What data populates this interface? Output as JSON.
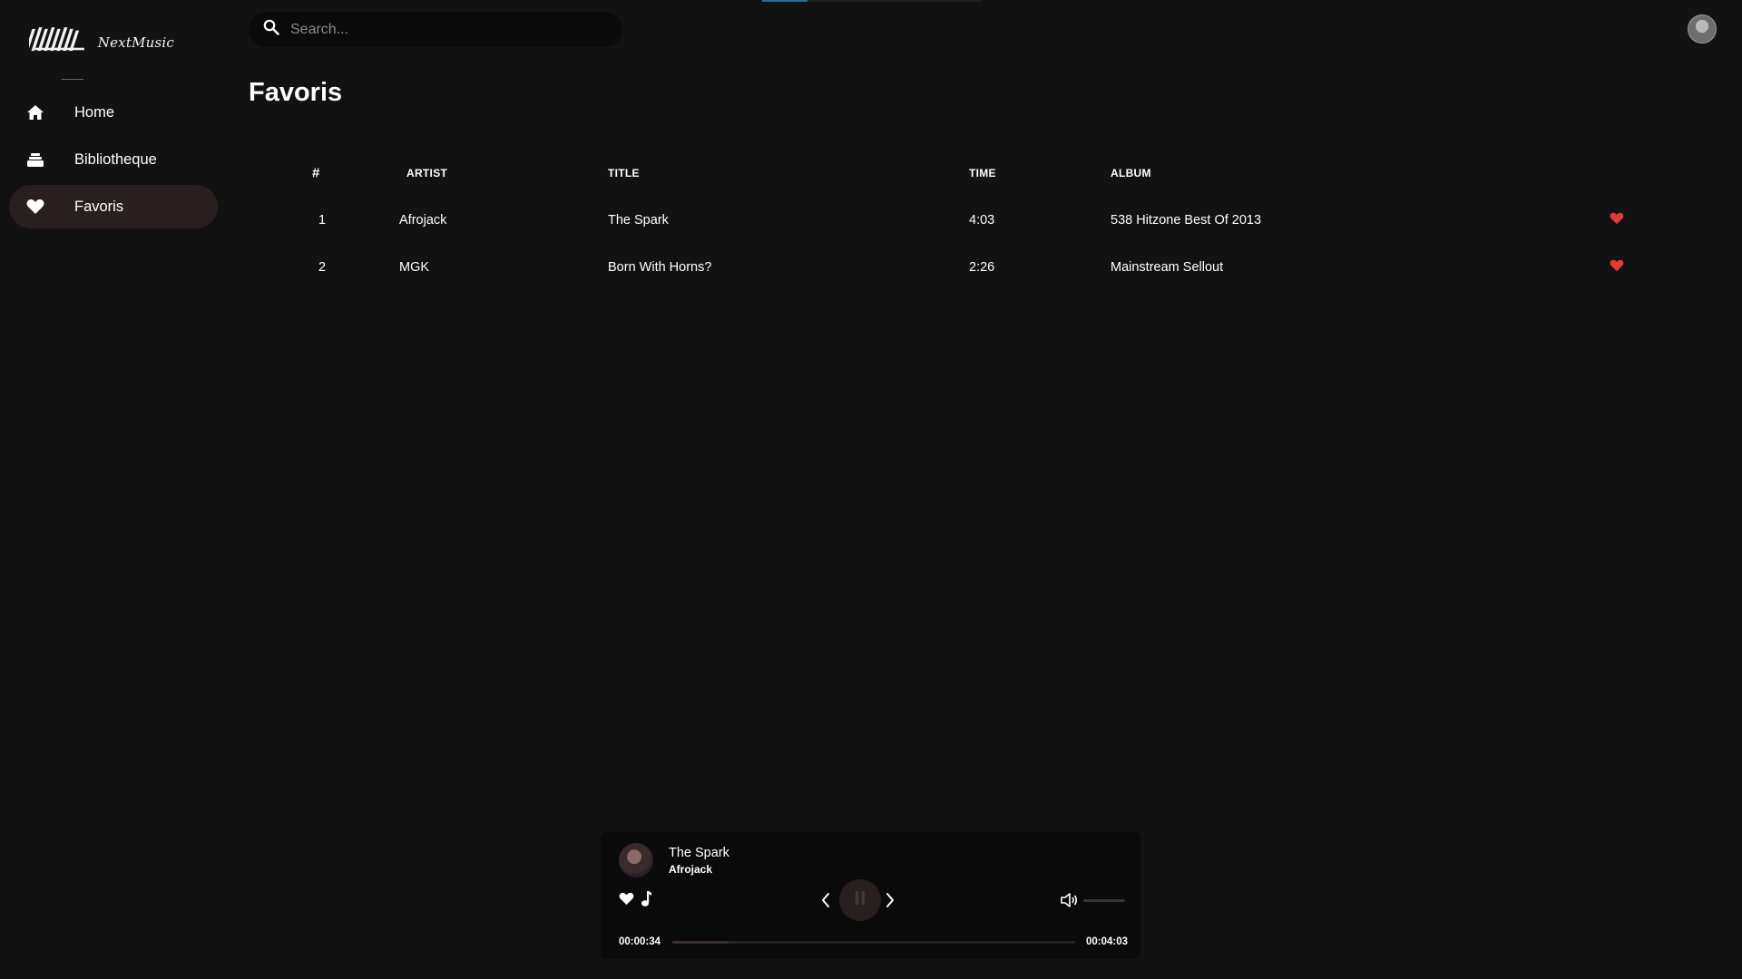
{
  "app": {
    "logo_text": "NextMusic"
  },
  "sidebar": {
    "items": [
      {
        "label": "Home",
        "icon": "home-icon",
        "active": false
      },
      {
        "label": "Bibliotheque",
        "icon": "library-icon",
        "active": true
      },
      {
        "label": "Favoris",
        "icon": "heart-icon",
        "active": true
      }
    ]
  },
  "header": {
    "search_placeholder": "Search..."
  },
  "page": {
    "title": "Favoris"
  },
  "table": {
    "columns": [
      "#",
      "ARTIST",
      "TITLE",
      "TIME",
      "ALBUM"
    ],
    "rows": [
      {
        "num": "1",
        "artist": "Afrojack",
        "title": "The Spark",
        "time": "4:03",
        "album": "538 Hitzone Best Of 2013",
        "favorite": true
      },
      {
        "num": "2",
        "artist": "MGK",
        "title": "Born With Horns?",
        "time": "2:26",
        "album": "Mainstream Sellout",
        "favorite": true
      }
    ]
  },
  "player": {
    "title": "The Spark",
    "artist": "Afrojack",
    "current_time": "00:00:34",
    "total_time": "00:04:03",
    "progress": 0.14,
    "volume": 0.0
  },
  "colors": {
    "background": "#121212",
    "active_nav": "#2a1f1f",
    "heart_red": "#e53935",
    "accent_blue": "#1d6fa5"
  }
}
